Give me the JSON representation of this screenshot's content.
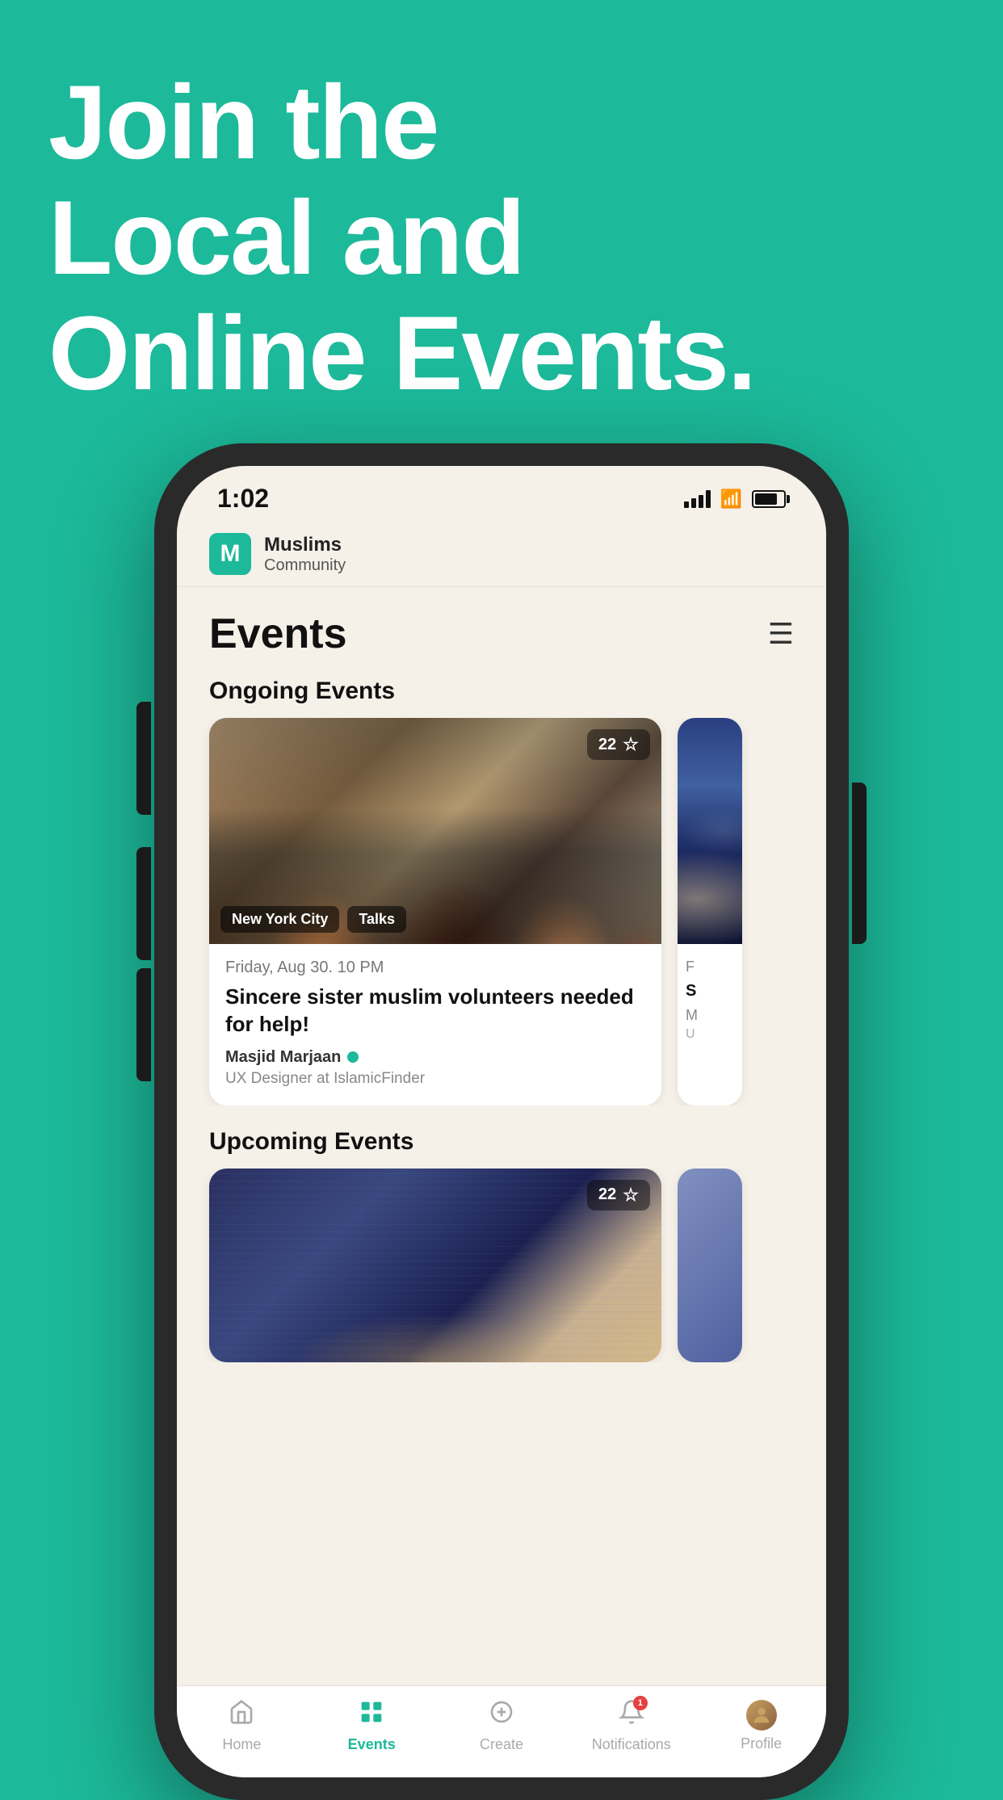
{
  "background_color": "#1CB99A",
  "hero": {
    "line1": "Join the",
    "line2": "Local and",
    "line3": "Online Events."
  },
  "status_bar": {
    "time": "1:02",
    "signal_bars": 4,
    "battery_percent": 80
  },
  "app_header": {
    "logo_letter": "M",
    "app_name": "Muslims",
    "app_subtitle": "Community"
  },
  "page": {
    "title": "Events",
    "filter_label": "filter"
  },
  "ongoing_section": {
    "label": "Ongoing Events",
    "cards": [
      {
        "image_alt": "Group of Muslim women smiling",
        "tags": [
          "New York City",
          "Talks"
        ],
        "favorite_count": "22",
        "date": "Friday, Aug 30. 10 PM",
        "title": "Sincere sister muslim volunteers needed for help!",
        "host_name": "Masjid Marjaan",
        "host_verified": true,
        "host_role": "UX Designer at IslamicFinder"
      }
    ]
  },
  "upcoming_section": {
    "label": "Upcoming Events",
    "cards": [
      {
        "image_alt": "Prayer beads and Quran",
        "favorite_count": "22"
      }
    ]
  },
  "bottom_nav": {
    "items": [
      {
        "icon": "home",
        "label": "Home",
        "active": false
      },
      {
        "icon": "grid",
        "label": "Events",
        "active": true
      },
      {
        "icon": "plus-circle",
        "label": "Create",
        "active": false
      },
      {
        "icon": "bell",
        "label": "Notifications",
        "active": false,
        "badge": "1"
      },
      {
        "icon": "person",
        "label": "Profile",
        "active": false,
        "has_avatar": true
      }
    ]
  }
}
